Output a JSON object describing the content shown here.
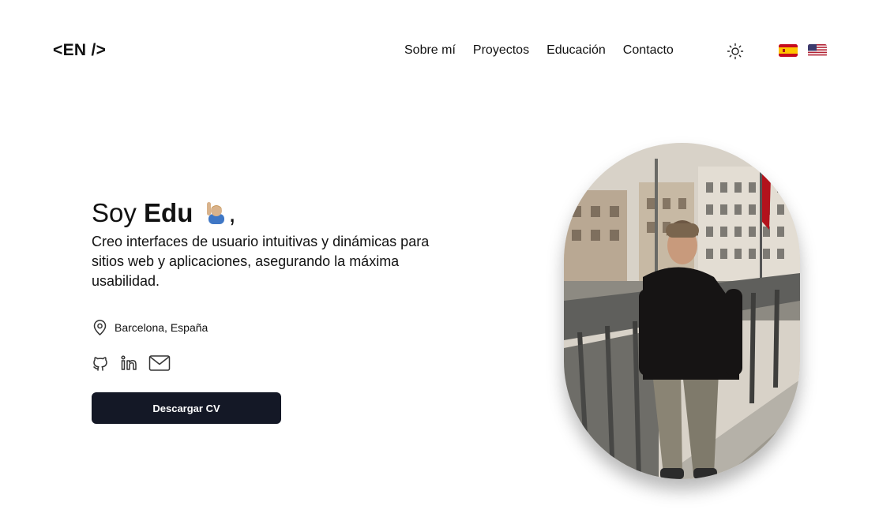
{
  "header": {
    "logo": "<EN />",
    "nav": [
      "Sobre mí",
      "Proyectos",
      "Educación",
      "Contacto"
    ],
    "theme_icon": "sun-icon",
    "languages": [
      {
        "code": "es",
        "icon": "spain-flag-icon"
      },
      {
        "code": "en",
        "icon": "us-flag-icon"
      }
    ]
  },
  "hero": {
    "greeting_prefix": "Soy ",
    "name": "Edu",
    "greeting_suffix": ",",
    "tagline": "Creo interfaces de usuario intuitivas y dinámicas para sitios web y aplicaciones, asegurando la máxima usabilidad.",
    "location": "Barcelona, España",
    "socials": [
      "github-icon",
      "linkedin-icon",
      "mail-icon"
    ],
    "cta_label": "Descargar CV"
  },
  "colors": {
    "text": "#111111",
    "button_bg": "#141826",
    "button_text": "#ffffff"
  }
}
